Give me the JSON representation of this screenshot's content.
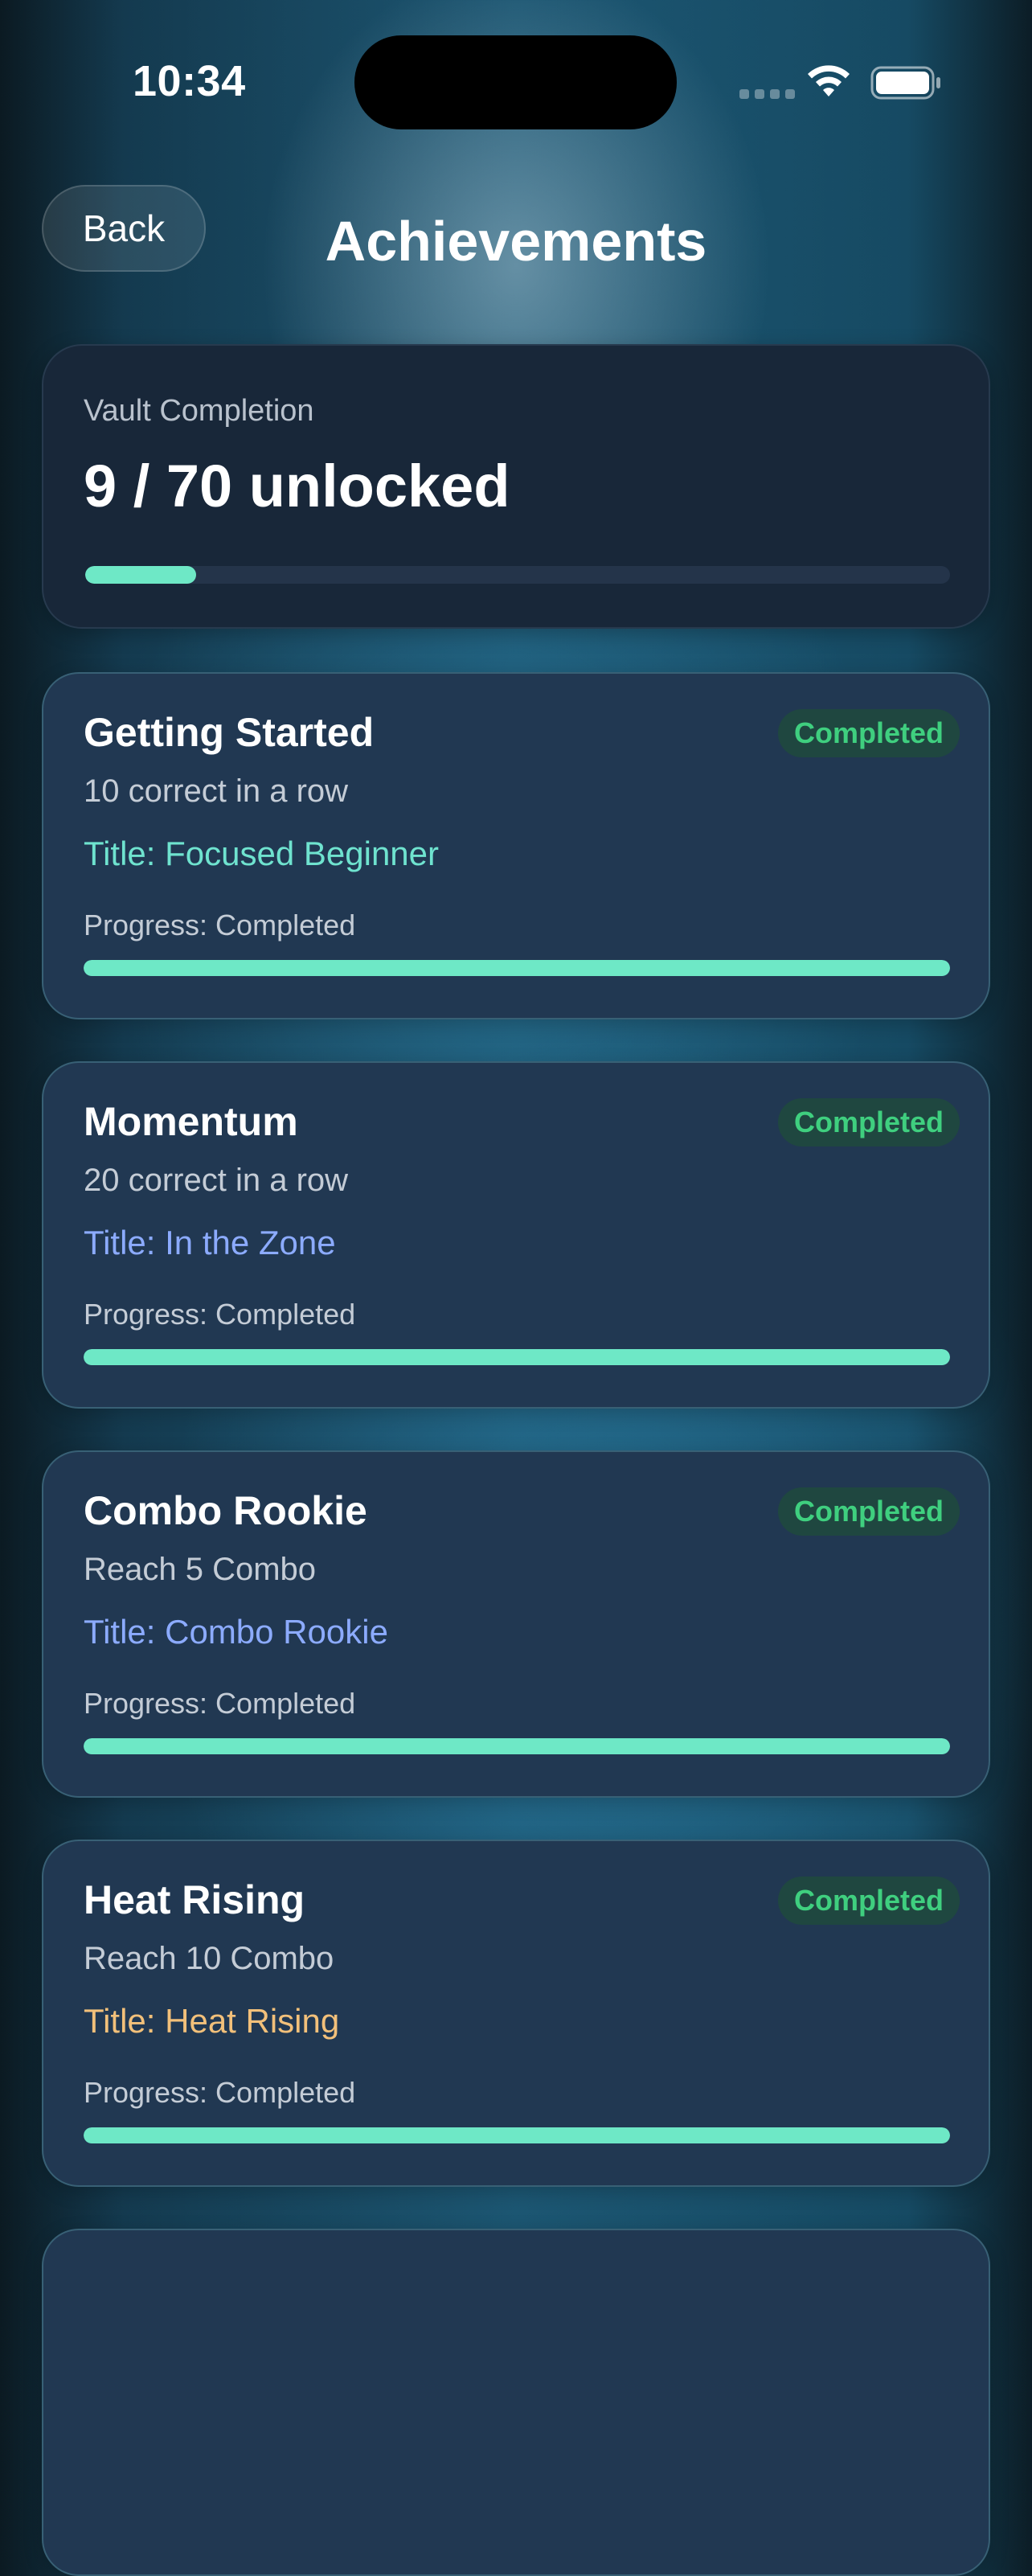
{
  "status_bar": {
    "time": "10:34",
    "icons": [
      "signal-dots-icon",
      "wifi-icon",
      "battery-icon"
    ]
  },
  "header": {
    "back_label": "Back",
    "title": "Achievements"
  },
  "vault": {
    "label": "Vault Completion",
    "value": "9 / 70 unlocked",
    "progress_fraction": 0.1286
  },
  "colors": {
    "accent_mint": "#6ee8c6",
    "completed_green": "#3fcf7f",
    "reward_teal": "#6fe3cf",
    "reward_blue": "#8cabff",
    "reward_gold": "#f2c07a"
  },
  "achievements": [
    {
      "title": "Getting Started",
      "status": "Completed",
      "requirement": "10 correct in a row",
      "reward": "Title: Focused Beginner",
      "reward_color": "#6fe3cf",
      "progress_text": "Progress: Completed",
      "progress_fraction": 1.0
    },
    {
      "title": "Momentum",
      "status": "Completed",
      "requirement": "20 correct in a row",
      "reward": "Title: In the Zone",
      "reward_color": "#8cabff",
      "progress_text": "Progress: Completed",
      "progress_fraction": 1.0
    },
    {
      "title": "Combo Rookie",
      "status": "Completed",
      "requirement": "Reach 5 Combo",
      "reward": "Title: Combo Rookie",
      "reward_color": "#8cabff",
      "progress_text": "Progress: Completed",
      "progress_fraction": 1.0
    },
    {
      "title": "Heat Rising",
      "status": "Completed",
      "requirement": "Reach 10 Combo",
      "reward": "Title: Heat Rising",
      "reward_color": "#f2c07a",
      "progress_text": "Progress: Completed",
      "progress_fraction": 1.0
    }
  ]
}
